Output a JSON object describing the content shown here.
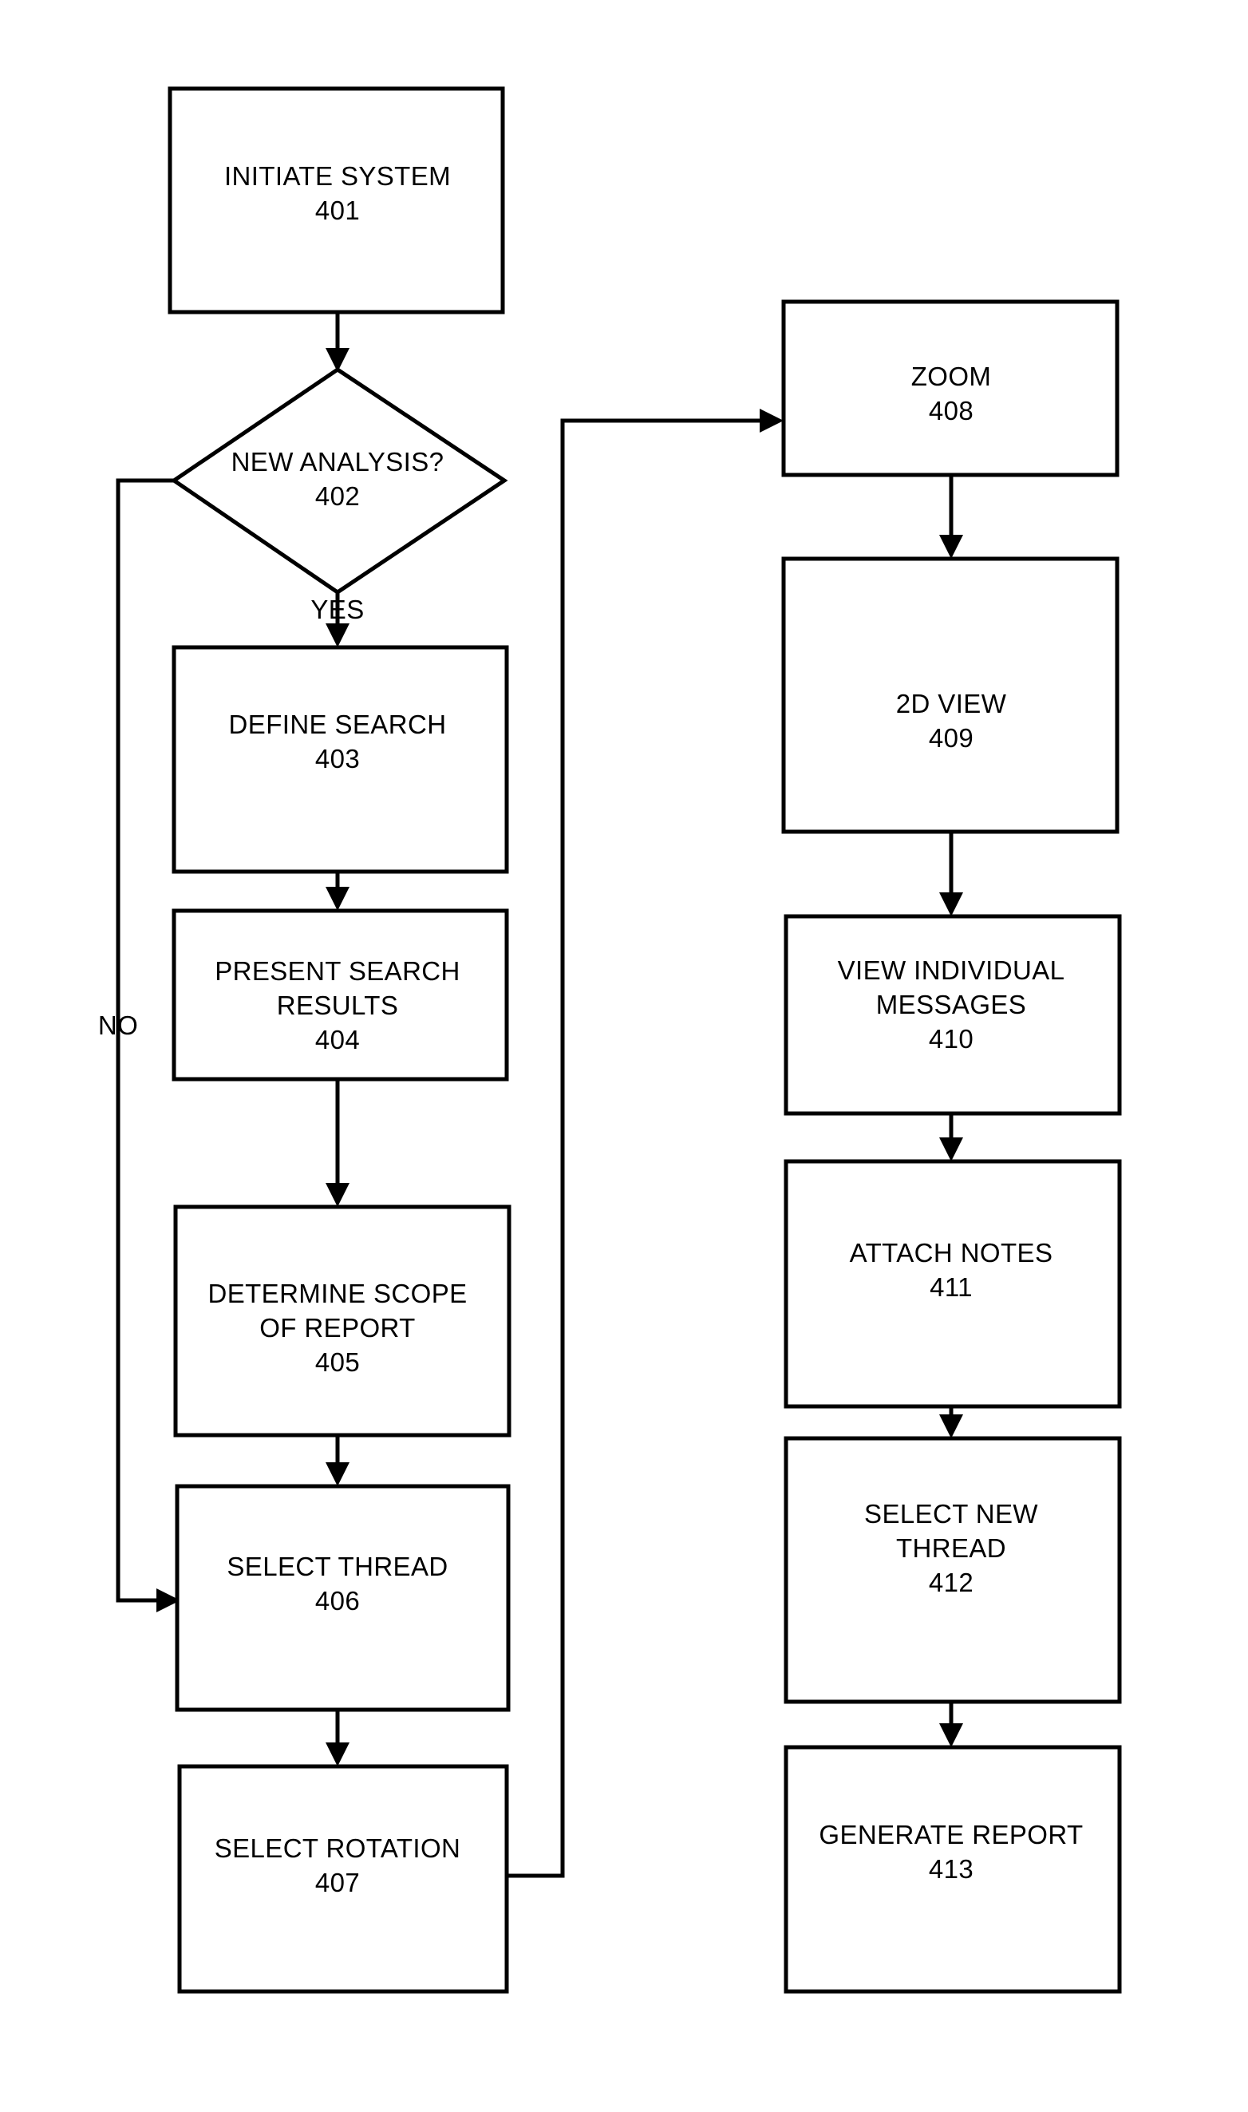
{
  "diagram": {
    "type": "flowchart",
    "title": "",
    "nodes": [
      {
        "id": "n401",
        "shape": "rect",
        "label": "INITIATE SYSTEM",
        "label2": "",
        "ref": "401"
      },
      {
        "id": "n402",
        "shape": "diamond",
        "label": "NEW ANALYSIS?",
        "label2": "",
        "ref": "402"
      },
      {
        "id": "n403",
        "shape": "rect",
        "label": "DEFINE SEARCH",
        "label2": "",
        "ref": "403"
      },
      {
        "id": "n404",
        "shape": "rect",
        "label": "PRESENT SEARCH",
        "label2": "RESULTS",
        "ref": "404"
      },
      {
        "id": "n405",
        "shape": "rect",
        "label": "DETERMINE SCOPE",
        "label2": "OF REPORT",
        "ref": "405"
      },
      {
        "id": "n406",
        "shape": "rect",
        "label": "SELECT THREAD",
        "label2": "",
        "ref": "406"
      },
      {
        "id": "n407",
        "shape": "rect",
        "label": "SELECT ROTATION",
        "label2": "",
        "ref": "407"
      },
      {
        "id": "n408",
        "shape": "rect",
        "label": "ZOOM",
        "label2": "",
        "ref": "408"
      },
      {
        "id": "n409",
        "shape": "rect",
        "label": "2D VIEW",
        "label2": "",
        "ref": "409"
      },
      {
        "id": "n410",
        "shape": "rect",
        "label": "VIEW INDIVIDUAL",
        "label2": "MESSAGES",
        "ref": "410"
      },
      {
        "id": "n411",
        "shape": "rect",
        "label": "ATTACH NOTES",
        "label2": "",
        "ref": "411"
      },
      {
        "id": "n412",
        "shape": "rect",
        "label": "SELECT NEW",
        "label2": "THREAD",
        "ref": "412"
      },
      {
        "id": "n413",
        "shape": "rect",
        "label": "GENERATE REPORT",
        "label2": "",
        "ref": "413"
      }
    ],
    "edge_labels": {
      "yes": "YES",
      "no": "NO"
    },
    "edges": [
      {
        "from": "n401",
        "to": "n402",
        "label": ""
      },
      {
        "from": "n402",
        "to": "n403",
        "label": "YES"
      },
      {
        "from": "n402",
        "to": "n406",
        "label": "NO"
      },
      {
        "from": "n403",
        "to": "n404",
        "label": ""
      },
      {
        "from": "n404",
        "to": "n405",
        "label": ""
      },
      {
        "from": "n405",
        "to": "n406",
        "label": ""
      },
      {
        "from": "n406",
        "to": "n407",
        "label": ""
      },
      {
        "from": "n407",
        "to": "n408",
        "label": ""
      },
      {
        "from": "n408",
        "to": "n409",
        "label": ""
      },
      {
        "from": "n409",
        "to": "n410",
        "label": ""
      },
      {
        "from": "n410",
        "to": "n411",
        "label": ""
      },
      {
        "from": "n411",
        "to": "n412",
        "label": ""
      },
      {
        "from": "n412",
        "to": "n413",
        "label": ""
      }
    ],
    "colors": {
      "stroke": "#000000",
      "fill": "#ffffff",
      "text": "#000000"
    }
  }
}
